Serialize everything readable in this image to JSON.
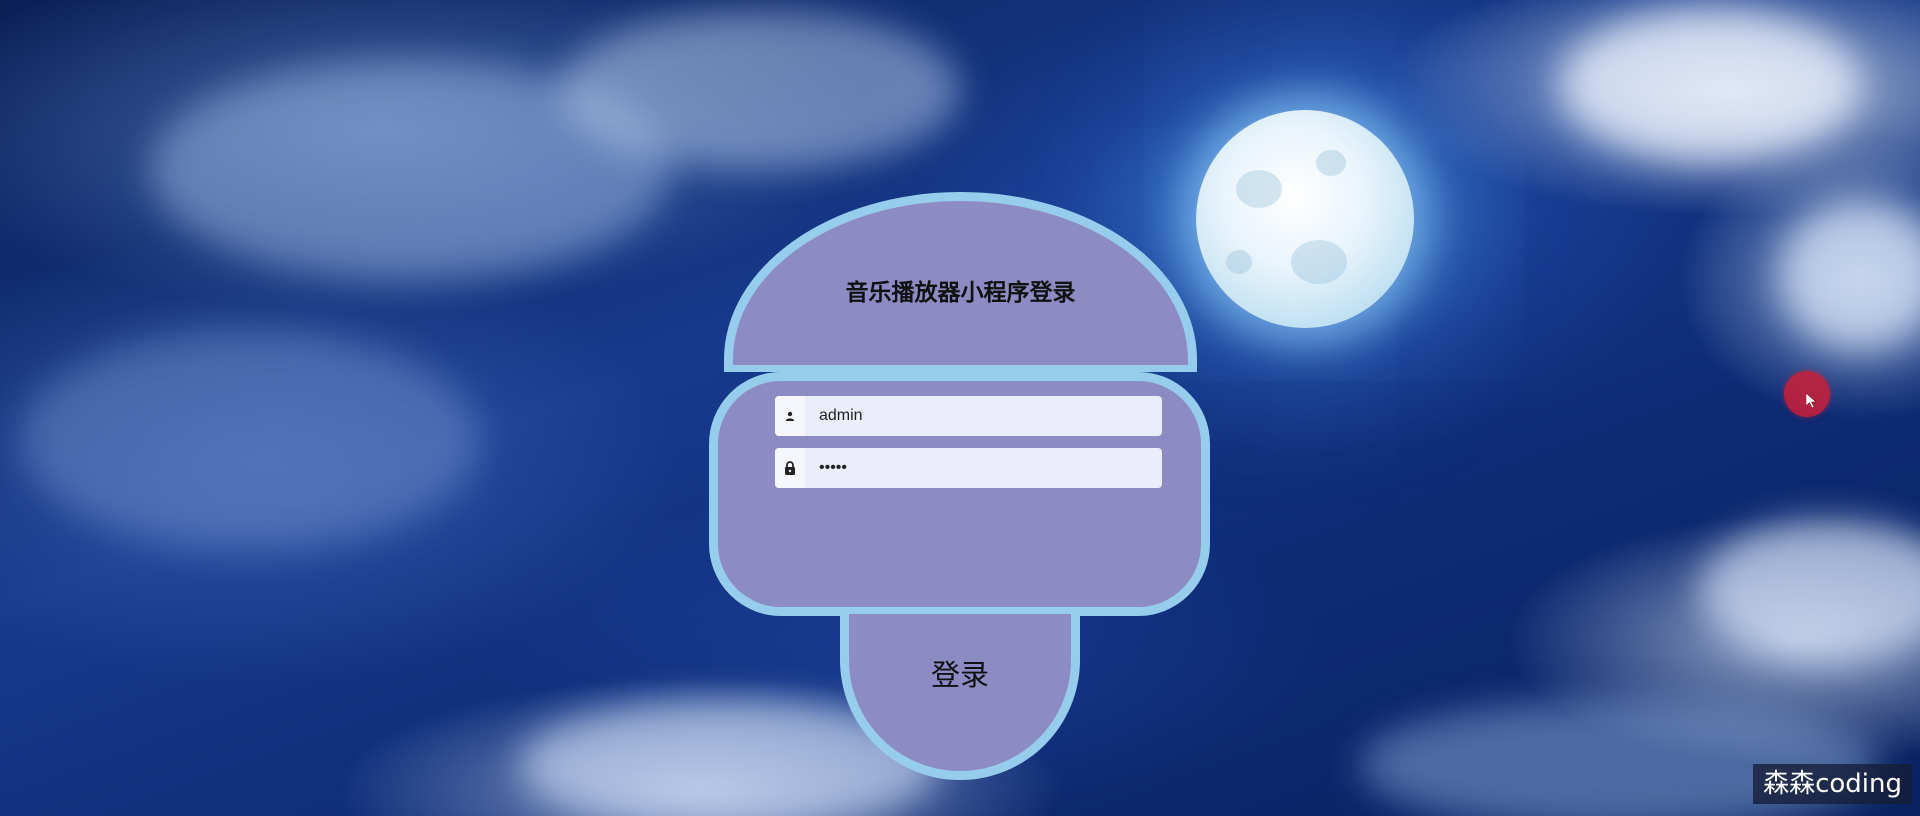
{
  "login": {
    "title": "音乐播放器小程序登录",
    "username_value": "admin",
    "password_value": "admin",
    "submit_label": "登录"
  },
  "icons": {
    "user": "user-icon",
    "lock": "lock-icon"
  },
  "watermark": "森森coding",
  "colors": {
    "panel_fill": "#8d8bc3",
    "panel_border": "#97cdec",
    "input_bg": "#ebeefa",
    "cursor": "#cd1e37"
  }
}
